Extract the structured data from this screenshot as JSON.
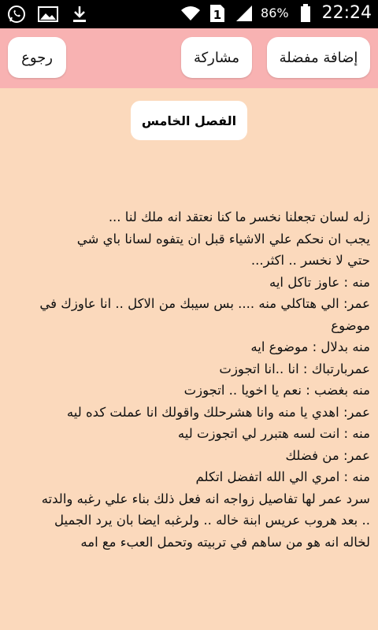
{
  "status_bar": {
    "battery_percent": "86%",
    "time": "22:24",
    "sim_badge": "1",
    "icons": [
      "whatsapp-icon",
      "image-icon",
      "download-icon",
      "wifi-icon",
      "sim-icon",
      "signal-icon",
      "battery-icon"
    ]
  },
  "action_bar": {
    "favorite_label": "إضافة مفضلة",
    "share_label": "مشاركة",
    "back_label": "رجوع",
    "background": "#f8b2b2"
  },
  "chapter": {
    "title": "الفصل الخامس"
  },
  "story": {
    "background": "#fbd9bc",
    "lines": [
      "زله لسان تجعلنا نخسر ما كنا نعتقد انه ملك لنا ...",
      "يجب ان نحكم علي الاشياء قبل ان يتفوه لسانا باي شي",
      "حتي لا نخسر .. اكثر...",
      "منه : عاوز تاكل ايه",
      "عمر: الي هتاكلي منه .... بس سيبك من الاكل .. انا عاوزك في",
      "موضوع",
      "منه بدلال : موضوع ايه",
      "عمربارتباك : انا ..انا اتجوزت",
      "منه بغضب : نعم يا اخويا .. اتجوزت",
      "عمر: اهدي يا منه وانا هشرحلك واقولك انا عملت كده ليه",
      "منه : انت لسه هتبرر لي اتجوزت ليه",
      "عمر: من فضلك",
      "منه : امري الي الله اتفضل اتكلم",
      "سرد عمر لها تفاصيل زواجه انه فعل ذلك بناء علي رغبه والدته",
      ".. بعد هروب عريس ابنة خاله .. ولرغبه ايضا بان يرد الجميل",
      "لخاله انه هو من ساهم في تربيته وتحمل العبء مع امه"
    ]
  }
}
